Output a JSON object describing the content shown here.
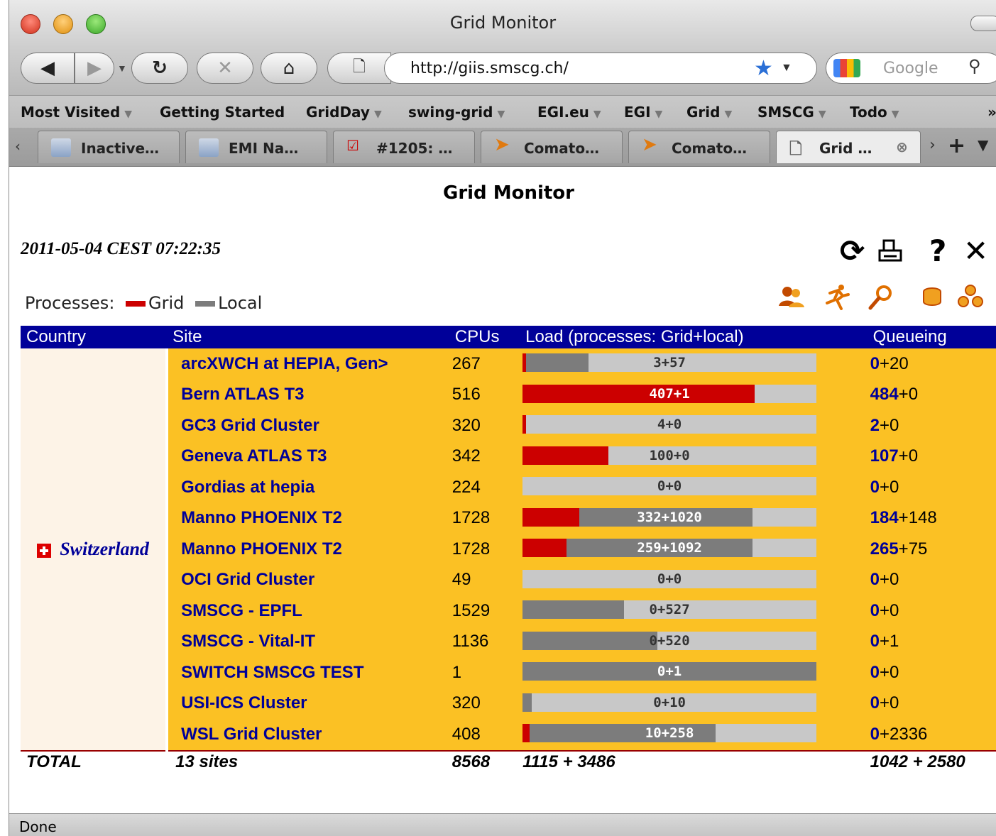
{
  "window": {
    "title": "Grid Monitor"
  },
  "toolbar": {
    "url": "http://giis.smscg.ch/",
    "search_placeholder": "Google"
  },
  "bookmarks": [
    {
      "label": "Most Visited",
      "menu": true
    },
    {
      "label": "Getting Started",
      "menu": false
    },
    {
      "label": "GridDay",
      "menu": true
    },
    {
      "label": "swing-grid",
      "menu": true
    },
    {
      "label": "EGI.eu",
      "menu": true
    },
    {
      "label": "EGI",
      "menu": true
    },
    {
      "label": "Grid",
      "menu": true
    },
    {
      "label": "SMSCG",
      "menu": true
    },
    {
      "label": "Todo",
      "menu": true
    }
  ],
  "tabs": [
    {
      "label": "Inactive…",
      "icon": "egi-icon",
      "active": false
    },
    {
      "label": "EMI Na…",
      "icon": "egi-icon",
      "active": false
    },
    {
      "label": "#1205: …",
      "icon": "checkbox-icon",
      "active": false
    },
    {
      "label": "Comato…",
      "icon": "comato-icon",
      "active": false
    },
    {
      "label": "Comato…",
      "icon": "comato-icon",
      "active": false
    },
    {
      "label": "Grid …",
      "icon": "page-icon",
      "active": true
    }
  ],
  "page": {
    "title": "Grid Monitor",
    "timestamp": "2011-05-04 CEST 07:22:35",
    "legend_prefix": "Processes:",
    "legend_grid": "Grid",
    "legend_local": "Local",
    "colors": {
      "grid": "#cc0000",
      "local": "#7c7c7c",
      "header": "#000099",
      "row": "#fbc124"
    }
  },
  "table": {
    "headers": {
      "country": "Country",
      "site": "Site",
      "cpus": "CPUs",
      "load": "Load (processes: Grid+local)",
      "queue": "Queueing"
    },
    "country": "Switzerland",
    "rows": [
      {
        "site": "arcXWCH at HEPIA, Gen>",
        "cpus": "267",
        "load": "3+57",
        "grid": 3,
        "local": 57,
        "queue_grid": "0",
        "queue_local": "+20"
      },
      {
        "site": "Bern ATLAS T3",
        "cpus": "516",
        "load": "407+1",
        "grid": 407,
        "local": 1,
        "queue_grid": "484",
        "queue_local": "+0"
      },
      {
        "site": "GC3 Grid Cluster",
        "cpus": "320",
        "load": "4+0",
        "grid": 4,
        "local": 0,
        "queue_grid": "2",
        "queue_local": "+0"
      },
      {
        "site": "Geneva ATLAS T3",
        "cpus": "342",
        "load": "100+0",
        "grid": 100,
        "local": 0,
        "queue_grid": "107",
        "queue_local": "+0"
      },
      {
        "site": "Gordias at hepia",
        "cpus": "224",
        "load": "0+0",
        "grid": 0,
        "local": 0,
        "queue_grid": "0",
        "queue_local": "+0"
      },
      {
        "site": "Manno PHOENIX T2",
        "cpus": "1728",
        "load": "332+1020",
        "grid": 332,
        "local": 1020,
        "queue_grid": "184",
        "queue_local": "+148"
      },
      {
        "site": "Manno PHOENIX T2",
        "cpus": "1728",
        "load": "259+1092",
        "grid": 259,
        "local": 1092,
        "queue_grid": "265",
        "queue_local": "+75"
      },
      {
        "site": "OCI Grid Cluster",
        "cpus": "49",
        "load": "0+0",
        "grid": 0,
        "local": 0,
        "queue_grid": "0",
        "queue_local": "+0"
      },
      {
        "site": "SMSCG - EPFL",
        "cpus": "1529",
        "load": "0+527",
        "grid": 0,
        "local": 527,
        "queue_grid": "0",
        "queue_local": "+0"
      },
      {
        "site": "SMSCG - Vital-IT",
        "cpus": "1136",
        "load": "0+520",
        "grid": 0,
        "local": 520,
        "queue_grid": "0",
        "queue_local": "+1"
      },
      {
        "site": "SWITCH SMSCG TEST",
        "cpus": "1",
        "load": "0+1",
        "grid": 0,
        "local": 1,
        "queue_grid": "0",
        "queue_local": "+0"
      },
      {
        "site": "USI-ICS Cluster",
        "cpus": "320",
        "load": "0+10",
        "grid": 0,
        "local": 10,
        "queue_grid": "0",
        "queue_local": "+0"
      },
      {
        "site": "WSL Grid Cluster",
        "cpus": "408",
        "load": "10+258",
        "grid": 10,
        "local": 258,
        "queue_grid": "0",
        "queue_local": "+2336"
      }
    ],
    "total": {
      "label": "TOTAL",
      "sites": "13 sites",
      "cpus": "8568",
      "load": "1115 + 3486",
      "queue": "1042 + 2580"
    }
  },
  "statusbar": {
    "text": "Done"
  }
}
